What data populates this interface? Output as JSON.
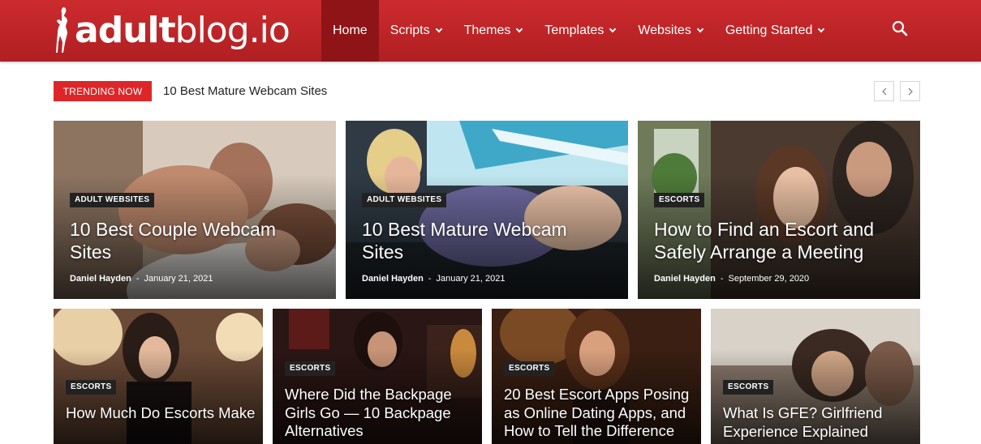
{
  "header": {
    "logo_bold": "adult",
    "logo_light": "blog.io",
    "nav": [
      {
        "label": "Home",
        "active": true,
        "dropdown": false
      },
      {
        "label": "Scripts",
        "active": false,
        "dropdown": true
      },
      {
        "label": "Themes",
        "active": false,
        "dropdown": true
      },
      {
        "label": "Templates",
        "active": false,
        "dropdown": true
      },
      {
        "label": "Websites",
        "active": false,
        "dropdown": true
      },
      {
        "label": "Getting Started",
        "active": false,
        "dropdown": true
      }
    ],
    "search_icon": "search-icon"
  },
  "trending": {
    "tag": "TRENDING NOW",
    "headline": "10 Best Mature Webcam Sites",
    "prev_icon": "chevron-left-icon",
    "next_icon": "chevron-right-icon"
  },
  "featured": [
    {
      "category": "ADULT WEBSITES",
      "title": "10 Best Couple Webcam Sites",
      "author": "Daniel Hayden",
      "date": "January 21, 2021"
    },
    {
      "category": "ADULT WEBSITES",
      "title": "10 Best Mature Webcam Sites",
      "author": "Daniel Hayden",
      "date": "January 21, 2021"
    },
    {
      "category": "ESCORTS",
      "title": "How to Find an Escort and Safely Arrange a Meeting",
      "author": "Daniel Hayden",
      "date": "September 29, 2020"
    }
  ],
  "secondary": [
    {
      "category": "ESCORTS",
      "title": "How Much Do Escorts Make"
    },
    {
      "category": "ESCORTS",
      "title": "Where Did the Backpage Girls Go — 10 Backpage Alternatives"
    },
    {
      "category": "ESCORTS",
      "title": "20 Best Escort Apps Posing as Online Dating Apps, and How to Tell the Difference"
    },
    {
      "category": "ESCORTS",
      "title": "What Is GFE? Girlfriend Experience Explained"
    }
  ],
  "colors": {
    "brand_red": "#c4262a",
    "active_nav": "#8e1417",
    "trend_tag": "#dd2628"
  }
}
